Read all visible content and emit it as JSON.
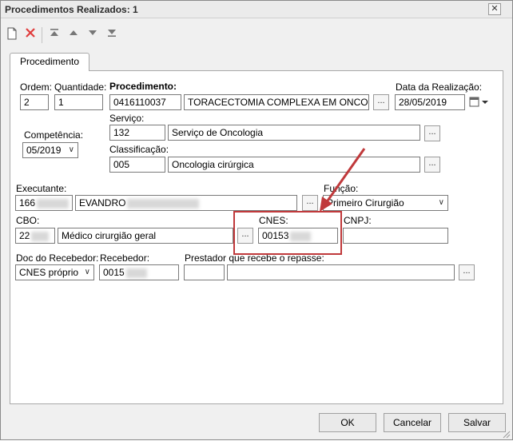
{
  "window": {
    "title": "Procedimentos Realizados: 1",
    "close_glyph": "✕"
  },
  "toolbar": {
    "icons": [
      "new-document-icon",
      "delete-icon",
      "move-first-icon",
      "move-up-icon",
      "move-down-icon",
      "move-last-icon"
    ],
    "delete_color": "#e03b3b"
  },
  "tabs": [
    {
      "label": "Procedimento"
    }
  ],
  "form": {
    "ordem": {
      "label": "Ordem:",
      "value": "2"
    },
    "quantidade": {
      "label": "Quantidade:",
      "value": "1"
    },
    "procedimento": {
      "label": "Procedimento:",
      "code": "0416110037",
      "description": "TORACECTOMIA COMPLEXA EM ONCOLOGIA"
    },
    "data_realizacao": {
      "label": "Data da Realização:",
      "value": "28/05/2019"
    },
    "competencia": {
      "label": "Competência:",
      "value": "05/2019"
    },
    "servico": {
      "label": "Serviço:",
      "code": "132",
      "description": "Serviço de Oncologia"
    },
    "classificacao": {
      "label": "Classificação:",
      "code": "005",
      "description": "Oncologia cirúrgica"
    },
    "executante": {
      "label": "Executante:",
      "code": "166",
      "name": "EVANDRO"
    },
    "funcao": {
      "label": "Função:",
      "value": "Primeiro Cirurgião"
    },
    "cbo": {
      "label": "CBO:",
      "code": "22",
      "description": "Médico cirurgião geral"
    },
    "cnes": {
      "label": "CNES:",
      "value": "00153"
    },
    "cnpj": {
      "label": "CNPJ:",
      "value": ""
    },
    "doc_recebedor": {
      "label": "Doc do Recebedor:",
      "value": "CNES próprio"
    },
    "recebedor": {
      "label": "Recebedor:",
      "value": "0015"
    },
    "prestador": {
      "label": "Prestador que recebe o repasse:",
      "code": "",
      "name": ""
    },
    "ellipsis": "..."
  },
  "footer": {
    "ok": "OK",
    "cancel": "Cancelar",
    "save": "Salvar"
  },
  "annotation": {
    "color": "#c0393b"
  }
}
